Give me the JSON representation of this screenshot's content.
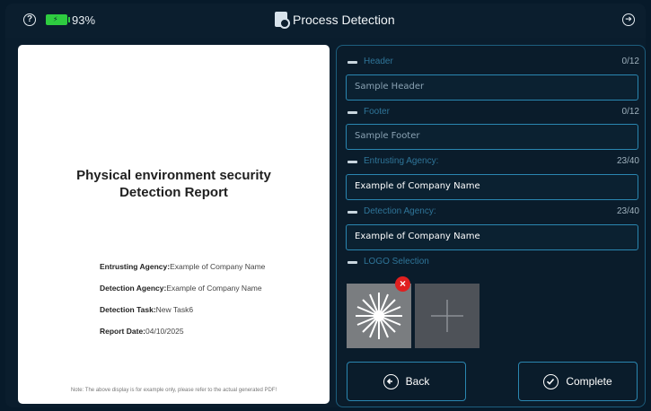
{
  "status": {
    "help_icon": "help-circle-icon",
    "battery_percent": "93%",
    "battery_color": "#2ecc40",
    "exit_icon": "exit-circle-icon"
  },
  "header": {
    "title": "Process Detection",
    "title_icon": "document-search-icon"
  },
  "preview": {
    "title_line1": "Physical environment security",
    "title_line2": "Detection Report",
    "meta": [
      {
        "label": "Entrusting Agency:",
        "value": "Example of Company Name"
      },
      {
        "label": "Detection Agency:",
        "value": "Example of Company Name"
      },
      {
        "label": "Detection Task:",
        "value": "New Task6"
      },
      {
        "label": "Report Date:",
        "value": "04/10/2025"
      }
    ],
    "note": "Note: The above display is for example only, please refer to the actual generated PDF!"
  },
  "form": {
    "header": {
      "label": "Header",
      "count": "0/12",
      "placeholder": "Sample Header"
    },
    "footer": {
      "label": "Footer",
      "count": "0/12",
      "placeholder": "Sample Footer"
    },
    "entrusting": {
      "label": "Entrusting Agency:",
      "count": "23/40",
      "value": "Example of Company Name"
    },
    "detection": {
      "label": "Detection Agency:",
      "count": "23/40",
      "value": "Example of Company Name"
    },
    "logo": {
      "label": "LOGO Selection"
    }
  },
  "buttons": {
    "back": "Back",
    "complete": "Complete"
  },
  "colors": {
    "accent": "#2a86b0",
    "section_label": "#2f7599",
    "remove": "#e02020"
  }
}
